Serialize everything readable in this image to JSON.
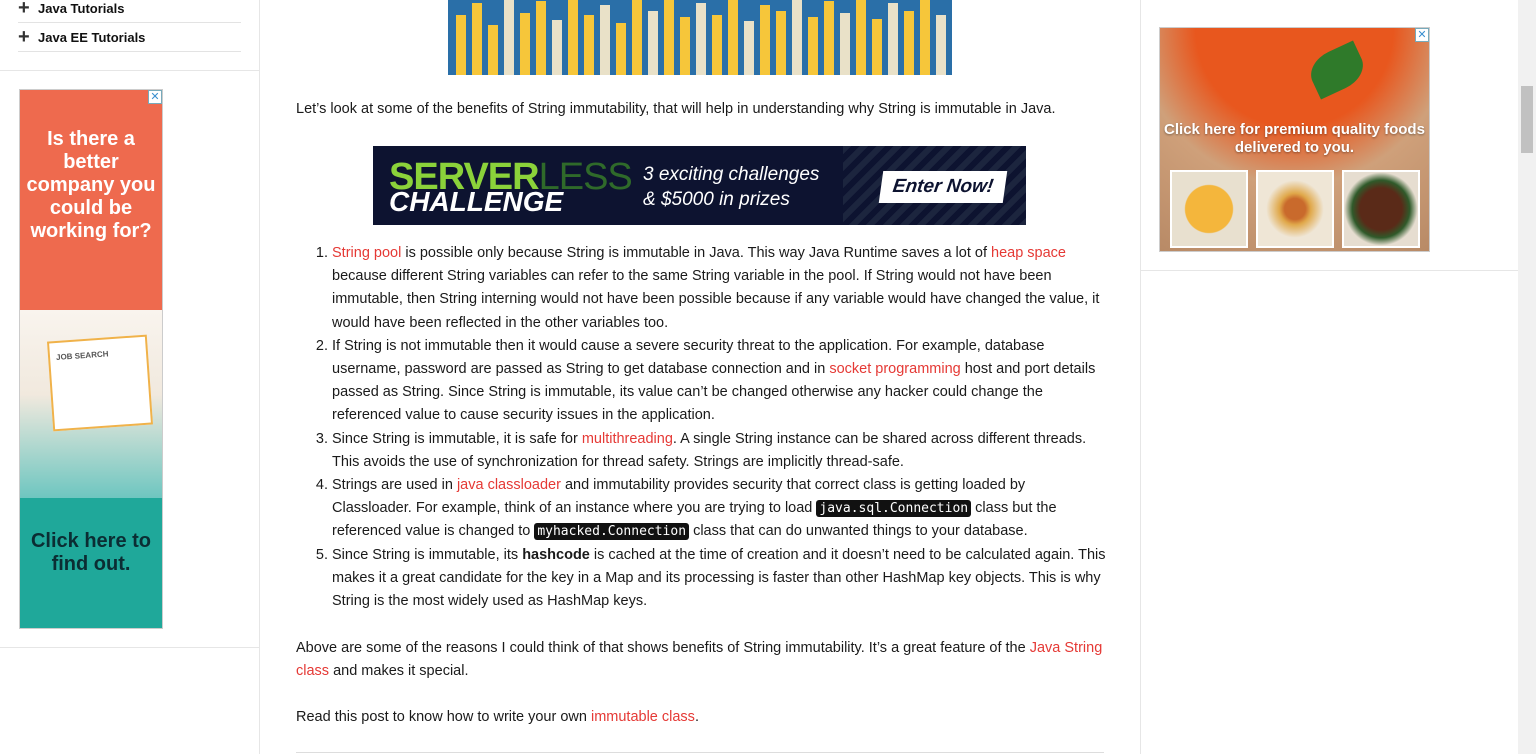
{
  "sidebar": {
    "items": [
      {
        "icon": "plus-icon",
        "label": "Java Tutorials"
      },
      {
        "icon": "plus-icon",
        "label": "Java EE Tutorials"
      }
    ],
    "ad": {
      "headline": "Is there a better company you could be working for?",
      "screen_text": "JOB SEARCH",
      "cta": "Click here to find out."
    }
  },
  "main": {
    "intro": "Let’s look at some of the benefits of String immutability, that will help in understanding why String is immutable in Java.",
    "serverless_ad": {
      "title_a": "SERVER",
      "title_b": "LESS",
      "title_c": "CHALLENGE",
      "line1": "3 exciting challenges",
      "line2": "& $5000 in prizes",
      "button": "Enter Now!"
    },
    "benefits": [
      {
        "link1": "String pool",
        "t1": " is possible only because String is immutable in Java. This way Java Runtime saves a lot of ",
        "link2": "heap space",
        "t2": " because different String variables can refer to the same String variable in the pool. If String would not have been immutable, then String interning would not have been possible because if any variable would have changed the value, it would have been reflected in the other variables too."
      },
      {
        "t1": "If String is not immutable then it would cause a severe security threat to the application. For example, database username, password are passed as String to get database connection and in ",
        "link1": "socket programming",
        "t2": " host and port details passed as String. Since String is immutable, its value can’t be changed otherwise any hacker could change the referenced value to cause security issues in the application."
      },
      {
        "t1": "Since String is immutable, it is safe for ",
        "link1": "multithreading",
        "t2": ". A single String instance can be shared across different threads. This avoids the use of synchronization for thread safety. Strings are implicitly thread-safe."
      },
      {
        "t1": "Strings are used in ",
        "link1": "java classloader",
        "t2": " and immutability provides security that correct class is getting loaded by Classloader. For example, think of an instance where you are trying to load ",
        "code1": "java.sql.Connection",
        "t3": " class but the referenced value is changed to ",
        "code2": "myhacked.Connection",
        "t4": " class that can do unwanted things to your database."
      },
      {
        "t1": "Since String is immutable, its ",
        "bold1": "hashcode",
        "t2": " is cached at the time of creation and it doesn’t need to be calculated again. This makes it a great candidate for the key in a Map and its processing is faster than other HashMap key objects. This is why String is the most widely used as HashMap keys."
      }
    ],
    "closing": {
      "t1": "Above are some of the reasons I could think of that shows benefits of String immutability. It’s a great feature of the ",
      "link": "Java String class",
      "t2": " and makes it special."
    },
    "read_post": {
      "t1": "Read this post to know how to write your own ",
      "link": "immutable class",
      "t2": "."
    }
  },
  "right_ad": {
    "tagline": "Click here for premium quality foods delivered to you."
  },
  "ad_close": "✕",
  "colors": {
    "link": "#e53935",
    "left_ad_top": "#ee6a4e",
    "left_ad_bottom": "#1fa89a"
  }
}
